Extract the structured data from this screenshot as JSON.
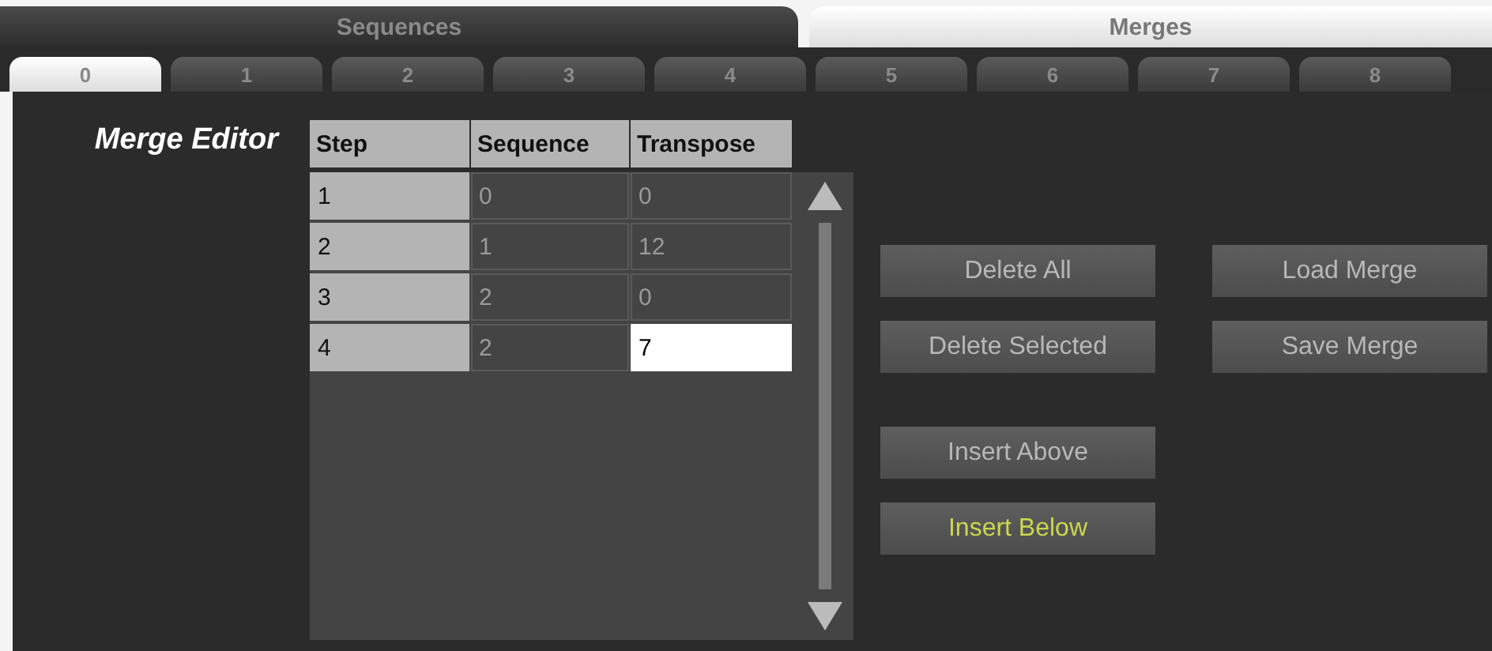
{
  "mode_tabs": [
    {
      "label": "Sequences",
      "selected": false
    },
    {
      "label": "Merges",
      "selected": true
    }
  ],
  "slot_tabs": [
    {
      "label": "0",
      "selected": true
    },
    {
      "label": "1",
      "selected": false
    },
    {
      "label": "2",
      "selected": false
    },
    {
      "label": "3",
      "selected": false
    },
    {
      "label": "4",
      "selected": false
    },
    {
      "label": "5",
      "selected": false
    },
    {
      "label": "6",
      "selected": false
    },
    {
      "label": "7",
      "selected": false
    },
    {
      "label": "8",
      "selected": false
    }
  ],
  "editor": {
    "title": "Merge Editor",
    "table": {
      "columns": [
        "Step",
        "Sequence",
        "Transpose"
      ],
      "rows": [
        {
          "cells": [
            {
              "text": "1",
              "selected": false
            },
            {
              "text": "0",
              "selected": false
            },
            {
              "text": "0",
              "selected": false
            }
          ]
        },
        {
          "cells": [
            {
              "text": "2",
              "selected": false
            },
            {
              "text": "1",
              "selected": false
            },
            {
              "text": "12",
              "selected": false
            }
          ]
        },
        {
          "cells": [
            {
              "text": "3",
              "selected": false
            },
            {
              "text": "2",
              "selected": false
            },
            {
              "text": "0",
              "selected": false
            }
          ]
        },
        {
          "cells": [
            {
              "text": "4",
              "selected": false
            },
            {
              "text": "2",
              "selected": false
            },
            {
              "text": "7",
              "selected": true
            }
          ]
        }
      ]
    },
    "buttons": [
      {
        "label": "Delete All",
        "highlighted": false
      },
      {
        "label": "Load Merge",
        "highlighted": false
      },
      {
        "label": "Delete Selected",
        "highlighted": false
      },
      {
        "label": "Save Merge",
        "highlighted": false
      },
      {
        "label": "Insert Above",
        "highlighted": false
      },
      {
        "label": "Insert Below",
        "highlighted": true
      }
    ]
  }
}
